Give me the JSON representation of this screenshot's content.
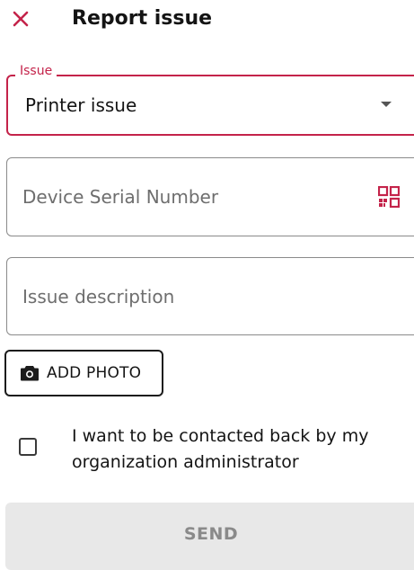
{
  "header": {
    "title": "Report issue",
    "close_icon": "close-icon",
    "close_color": "#c4234a"
  },
  "issue_select": {
    "label": "Issue",
    "value": "Printer issue",
    "accent_color": "#c4234a"
  },
  "serial_field": {
    "placeholder": "Device Serial Number",
    "value": "",
    "scan_icon": "qr-code-icon",
    "scan_icon_color": "#c4234a"
  },
  "description_field": {
    "placeholder": "Issue description",
    "value": ""
  },
  "add_photo": {
    "label": "ADD PHOTO",
    "icon": "camera-icon"
  },
  "contact_checkbox": {
    "checked": false,
    "label": "I want to be contacted back by my organization administrator"
  },
  "send_button": {
    "label": "SEND",
    "disabled": true
  }
}
